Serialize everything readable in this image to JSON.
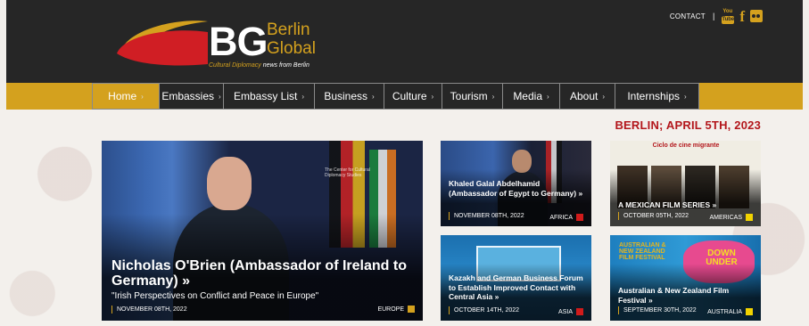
{
  "header": {
    "logo": {
      "bg": "BG",
      "berlin": "Berlin",
      "global": "Global",
      "tagline_a": "Cultural Diplomacy",
      "tagline_b": "news from Berlin"
    },
    "top_links": {
      "contact": "CONTACT",
      "separator": "|",
      "youtube_top": "You",
      "youtube_bottom": "Tube",
      "facebook": "f"
    }
  },
  "nav": {
    "items": [
      {
        "label": "Home",
        "active": true
      },
      {
        "label": "Embassies"
      },
      {
        "label": "Embassy List"
      },
      {
        "label": "Business"
      },
      {
        "label": "Culture"
      },
      {
        "label": "Tourism"
      },
      {
        "label": "Media"
      },
      {
        "label": "About"
      },
      {
        "label": "Internships"
      }
    ],
    "arrow": "›"
  },
  "dateline": "BERLIN; APRIL 5TH, 2023",
  "colors": {
    "header_bg": "#262626",
    "accent_gold": "#d4a11e",
    "date_red": "#b3161b",
    "cat_africa": "#d11b1b",
    "cat_europe": "#d4a11e",
    "cat_americas": "#f2d300",
    "cat_asia": "#d11b1b",
    "cat_australia": "#f2d300"
  },
  "cards": {
    "main": {
      "title": "Nicholas O'Brien (Ambassador of Ireland to Germany) »",
      "subtitle": "\"Irish Perspectives on Conflict and Peace in Europe\"",
      "date": "NOVEMBER 08TH, 2022",
      "category": "EUROPE",
      "banner": "The Center for Cultural Diplomacy Studies"
    },
    "s1": {
      "title": "Khaled Galal Abdelhamid (Ambassador of Egypt to Germany) »",
      "date": "NOVEMBER 08TH, 2022",
      "category": "AFRICA"
    },
    "s2": {
      "title": "A MEXICAN FILM SERIES »",
      "date": "OCTOBER 05TH, 2022",
      "category": "AMERICAS",
      "poster_headline": "Ciclo de cine migrante"
    },
    "s3": {
      "title": "Kazakh and German Business Forum to Establish Improved Contact with Central Asia »",
      "date": "OCTOBER 14TH, 2022",
      "category": "ASIA"
    },
    "s4": {
      "title": "Australian & New Zealand Film Festival »",
      "date": "SEPTEMBER 30TH, 2022",
      "category": "AUSTRALIA",
      "poster_label": "AUSTRALIAN & NEW ZEALAND FILM FESTIVAL",
      "poster_badge": "DOWN UNDER"
    }
  }
}
